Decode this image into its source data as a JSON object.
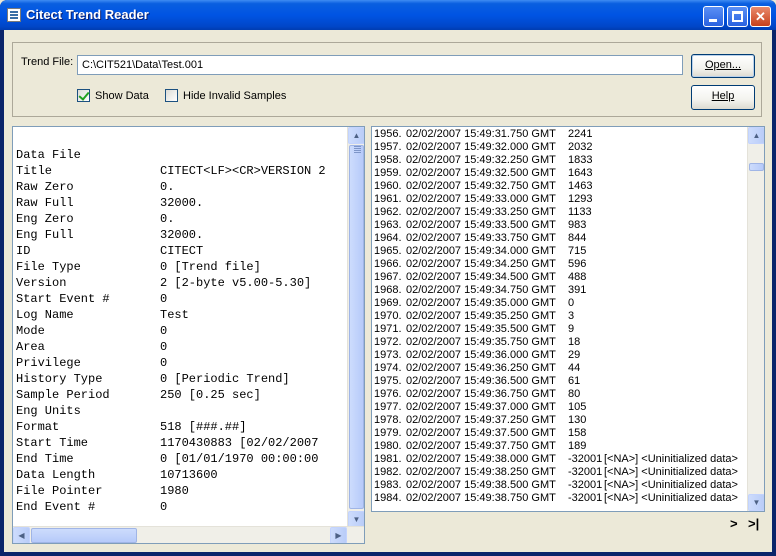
{
  "window": {
    "title": "Citect Trend Reader"
  },
  "top": {
    "trend_file_label": "Trend File:",
    "trend_file_value": "C:\\CIT521\\Data\\Test.001",
    "open_label": "Open...",
    "help_label": "Help",
    "show_data_label": "Show Data",
    "show_data_checked": true,
    "hide_invalid_label": "Hide Invalid Samples",
    "hide_invalid_checked": false
  },
  "header_info": [
    {
      "key": "Data File",
      "value": ""
    },
    {
      "key": "Title",
      "value": "CITECT<LF><CR>VERSION 2"
    },
    {
      "key": "Raw Zero",
      "value": "0."
    },
    {
      "key": "Raw Full",
      "value": "32000."
    },
    {
      "key": "Eng Zero",
      "value": "0."
    },
    {
      "key": "Eng Full",
      "value": "32000."
    },
    {
      "key": "ID",
      "value": "CITECT"
    },
    {
      "key": "File Type",
      "value": "0 [Trend file]"
    },
    {
      "key": "Version",
      "value": "2 [2-byte v5.00-5.30]"
    },
    {
      "key": "Start Event #",
      "value": "0"
    },
    {
      "key": "Log Name",
      "value": "Test"
    },
    {
      "key": "Mode",
      "value": "0"
    },
    {
      "key": "Area",
      "value": "0"
    },
    {
      "key": "Privilege",
      "value": "0"
    },
    {
      "key": "History Type",
      "value": "0 [Periodic Trend]"
    },
    {
      "key": "Sample Period",
      "value": "250 [0.25 sec]"
    },
    {
      "key": "Eng Units",
      "value": ""
    },
    {
      "key": "Format",
      "value": "518 [###.##]"
    },
    {
      "key": "Start Time",
      "value": "1170430883 [02/02/2007"
    },
    {
      "key": "End Time",
      "value": "0 [01/01/1970 00:00:00"
    },
    {
      "key": "Data Length",
      "value": "10713600"
    },
    {
      "key": "File Pointer",
      "value": "1980"
    },
    {
      "key": "End Event #",
      "value": "0"
    }
  ],
  "samples": [
    {
      "index": "1956.",
      "time": "02/02/2007 15:49:31.750 GMT",
      "value": "2241",
      "note": ""
    },
    {
      "index": "1957.",
      "time": "02/02/2007 15:49:32.000 GMT",
      "value": "2032",
      "note": ""
    },
    {
      "index": "1958.",
      "time": "02/02/2007 15:49:32.250 GMT",
      "value": "1833",
      "note": ""
    },
    {
      "index": "1959.",
      "time": "02/02/2007 15:49:32.500 GMT",
      "value": "1643",
      "note": ""
    },
    {
      "index": "1960.",
      "time": "02/02/2007 15:49:32.750 GMT",
      "value": "1463",
      "note": ""
    },
    {
      "index": "1961.",
      "time": "02/02/2007 15:49:33.000 GMT",
      "value": "1293",
      "note": ""
    },
    {
      "index": "1962.",
      "time": "02/02/2007 15:49:33.250 GMT",
      "value": "1133",
      "note": ""
    },
    {
      "index": "1963.",
      "time": "02/02/2007 15:49:33.500 GMT",
      "value": "983",
      "note": ""
    },
    {
      "index": "1964.",
      "time": "02/02/2007 15:49:33.750 GMT",
      "value": "844",
      "note": ""
    },
    {
      "index": "1965.",
      "time": "02/02/2007 15:49:34.000 GMT",
      "value": "715",
      "note": ""
    },
    {
      "index": "1966.",
      "time": "02/02/2007 15:49:34.250 GMT",
      "value": "596",
      "note": ""
    },
    {
      "index": "1967.",
      "time": "02/02/2007 15:49:34.500 GMT",
      "value": "488",
      "note": ""
    },
    {
      "index": "1968.",
      "time": "02/02/2007 15:49:34.750 GMT",
      "value": "391",
      "note": ""
    },
    {
      "index": "1969.",
      "time": "02/02/2007 15:49:35.000 GMT",
      "value": "0",
      "note": ""
    },
    {
      "index": "1970.",
      "time": "02/02/2007 15:49:35.250 GMT",
      "value": "3",
      "note": ""
    },
    {
      "index": "1971.",
      "time": "02/02/2007 15:49:35.500 GMT",
      "value": "9",
      "note": ""
    },
    {
      "index": "1972.",
      "time": "02/02/2007 15:49:35.750 GMT",
      "value": "18",
      "note": ""
    },
    {
      "index": "1973.",
      "time": "02/02/2007 15:49:36.000 GMT",
      "value": "29",
      "note": ""
    },
    {
      "index": "1974.",
      "time": "02/02/2007 15:49:36.250 GMT",
      "value": "44",
      "note": ""
    },
    {
      "index": "1975.",
      "time": "02/02/2007 15:49:36.500 GMT",
      "value": "61",
      "note": ""
    },
    {
      "index": "1976.",
      "time": "02/02/2007 15:49:36.750 GMT",
      "value": "80",
      "note": ""
    },
    {
      "index": "1977.",
      "time": "02/02/2007 15:49:37.000 GMT",
      "value": "105",
      "note": ""
    },
    {
      "index": "1978.",
      "time": "02/02/2007 15:49:37.250 GMT",
      "value": "130",
      "note": ""
    },
    {
      "index": "1979.",
      "time": "02/02/2007 15:49:37.500 GMT",
      "value": "158",
      "note": ""
    },
    {
      "index": "1980.",
      "time": "02/02/2007 15:49:37.750 GMT",
      "value": "189",
      "note": ""
    },
    {
      "index": "1981.",
      "time": "02/02/2007 15:49:38.000 GMT",
      "value": "-32001",
      "note": "[<NA>] <Uninitialized data>"
    },
    {
      "index": "1982.",
      "time": "02/02/2007 15:49:38.250 GMT",
      "value": "-32001",
      "note": "[<NA>] <Uninitialized data>"
    },
    {
      "index": "1983.",
      "time": "02/02/2007 15:49:38.500 GMT",
      "value": "-32001",
      "note": "[<NA>] <Uninitialized data>"
    },
    {
      "index": "1984.",
      "time": "02/02/2007 15:49:38.750 GMT",
      "value": "-32001",
      "note": "[<NA>] <Uninitialized data>"
    }
  ],
  "nav": {
    "next": ">",
    "last": ">|"
  },
  "icons": {
    "app": "trend-reader-icon",
    "minimize": "minimize-icon",
    "maximize": "maximize-icon",
    "close": "close-icon"
  }
}
